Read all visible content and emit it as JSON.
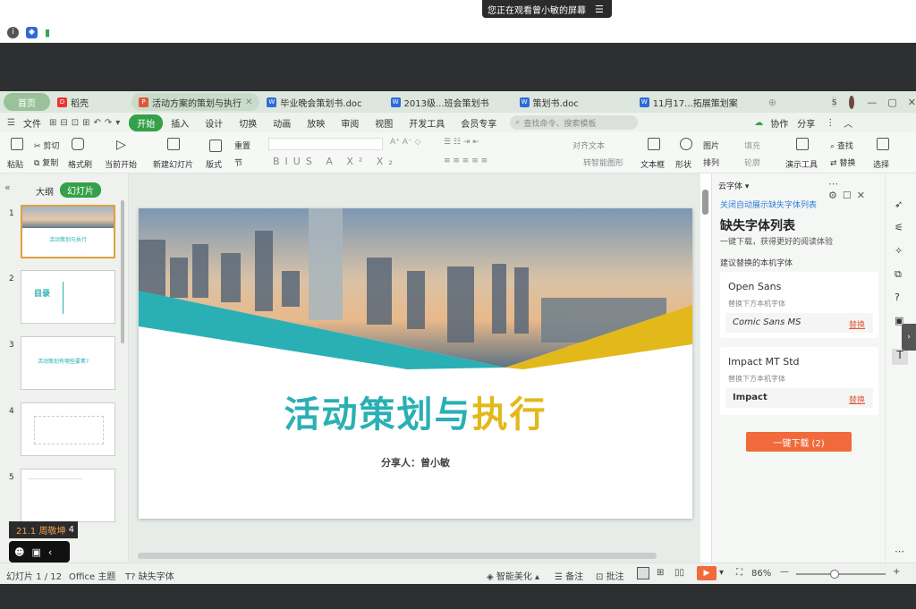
{
  "screen_share_banner": {
    "text": "您正在观看曾小敏的屏幕"
  },
  "tabs": [
    {
      "label": "首页"
    },
    {
      "label": "稻壳"
    },
    {
      "label": "活动方案的策划与执行"
    },
    {
      "label": "毕业晚会策划书.doc"
    },
    {
      "label": "2013级...班会策划书"
    },
    {
      "label": "策划书.doc"
    },
    {
      "label": "11月17...拓展策划案"
    }
  ],
  "menubar": {
    "file": "文件",
    "items": [
      "开始",
      "插入",
      "设计",
      "切换",
      "动画",
      "放映",
      "审阅",
      "视图",
      "开发工具",
      "会员专享"
    ],
    "search_placeholder": "查找命令、搜索模板",
    "collab": "协作",
    "share": "分享"
  },
  "ribbon": {
    "paste": "粘贴",
    "cut": "剪切",
    "copy": "复制",
    "format_painter": "格式刷",
    "from_current": "当前开始",
    "new_slide": "新建幻灯片",
    "layout": "版式",
    "reset": "重置",
    "section": "节",
    "align_text": "对齐文本",
    "smartart": "转智能图形",
    "textbox": "文本框",
    "shape": "形状",
    "picture": "图片",
    "arrange": "排列",
    "fill": "填充",
    "outline": "轮廓",
    "presentation_tools": "演示工具",
    "find": "查找",
    "replace": "替换",
    "select": "选择"
  },
  "sidebar": {
    "tab_outline": "大纲",
    "tab_slides": "幻灯片",
    "thumbs": [
      {
        "num": "1",
        "title": "活动策划与执行"
      },
      {
        "num": "2",
        "title": "目录"
      },
      {
        "num": "3",
        "title": "活动策划有哪些要素?"
      },
      {
        "num": "4",
        "title": ""
      },
      {
        "num": "5",
        "title": ""
      }
    ]
  },
  "slide": {
    "title_part1": "活动策划与",
    "title_part2": "执行",
    "presenter": "分享人：曾小敏"
  },
  "right_panel": {
    "header": "云字体",
    "link": "关闭自动展示缺失字体列表",
    "title": "缺失字体列表",
    "subtitle": "一键下载，获得更好的阅读体验",
    "suggest": "建议替换的本机字体",
    "fonts": [
      {
        "name": "Open Sans",
        "hint": "替换下方本机字体",
        "replacement": "Comic Sans MS",
        "action": "替换"
      },
      {
        "name": "Impact MT Std",
        "hint": "替换下方本机字体",
        "replacement": "Impact",
        "action": "替换"
      }
    ],
    "download_button": "一键下载 (2)"
  },
  "statusbar": {
    "slide_counter": "幻灯片 1 / 12",
    "theme": "Office 主题",
    "missing_font": "缺失字体",
    "smart_beautify": "智能美化",
    "notes": "备注",
    "comments": "批注",
    "zoom": "86%"
  },
  "overlay": {
    "user_badge": "21.1 周敬坤",
    "count": "4"
  },
  "colors": {
    "accent_green": "#34a14a",
    "teal": "#2ab0b4",
    "yellow": "#e3b81a",
    "orange_button": "#f06a3c"
  }
}
